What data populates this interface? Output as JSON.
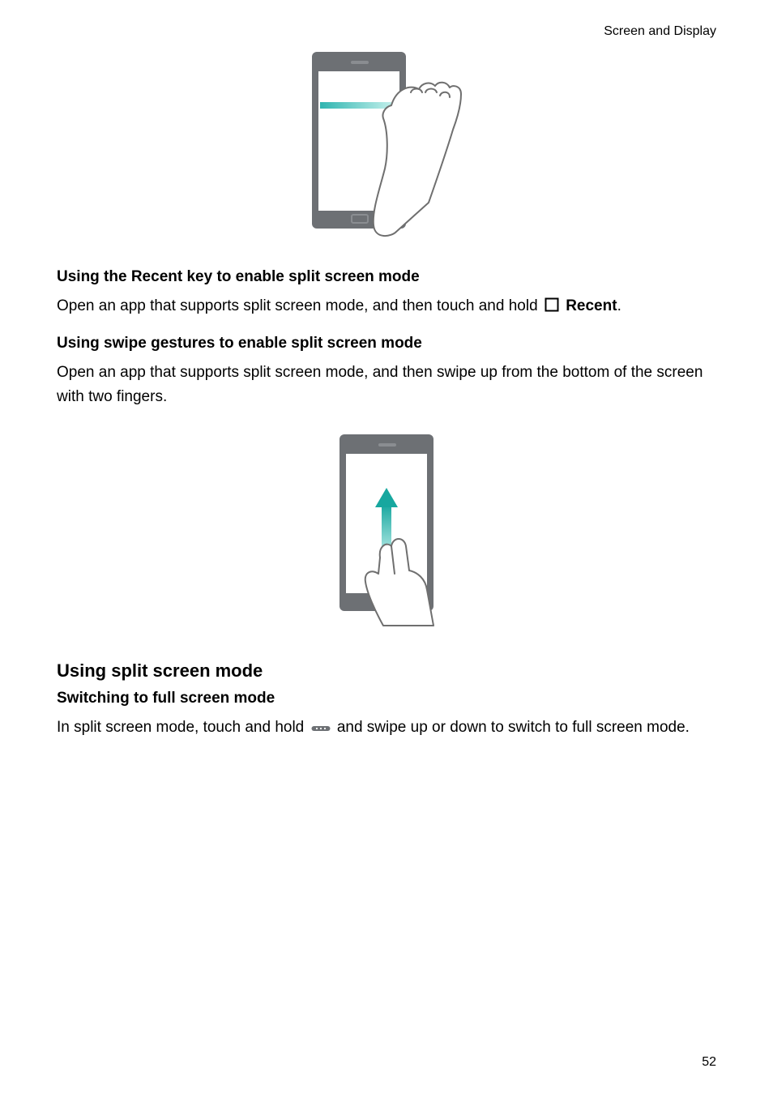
{
  "header": {
    "section_label": "Screen and Display"
  },
  "section1": {
    "heading": "Using the Recent key to enable split screen mode",
    "line1_a": "Open an app that supports split screen mode, and then touch and hold ",
    "line1_b_bold": "Recent",
    "line1_c": "."
  },
  "section2": {
    "heading": "Using swipe gestures to enable split screen mode",
    "body": "Open an app that supports split screen mode, and then swipe up from the bottom of the screen with two fingers."
  },
  "section3": {
    "title": "Using split screen mode",
    "sub_heading": "Switching to full screen mode",
    "line_a": "In split screen mode, touch and hold ",
    "line_b": " and swipe up or down to switch to full screen mode."
  },
  "footer": {
    "page_number": "52"
  }
}
